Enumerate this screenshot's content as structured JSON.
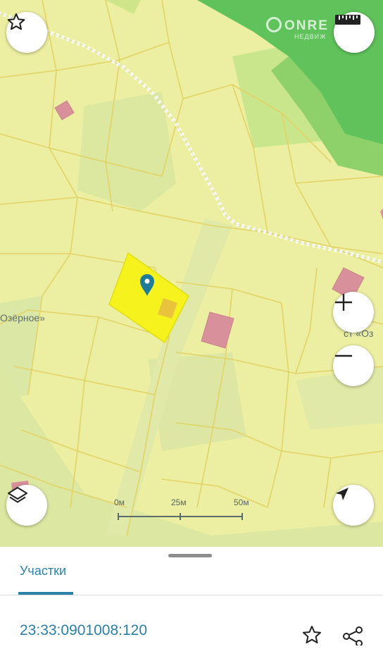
{
  "map": {
    "place_label_left": "Озёрное»",
    "place_label_right": "ст «Оз",
    "watermark": {
      "brand": "ONRE",
      "sub": "НЕДВИЖ",
      "icon": "onre-logo-icon"
    },
    "colors": {
      "parcel": "#ecefa1",
      "selected_parcel": "#f5f21e",
      "building": "#d8909a",
      "forest": "#5fc25a",
      "boundary_line": "#e5d86b"
    }
  },
  "controls": {
    "favorite_icon": "star-outline-icon",
    "measure_icon": "ruler-icon",
    "zoom_in_icon": "plus-icon",
    "zoom_out_icon": "minus-icon",
    "layers_icon": "layers-icon",
    "locate_icon": "navigation-arrow-icon"
  },
  "scale": {
    "labels": [
      "0м",
      "25м",
      "50м"
    ]
  },
  "sheet": {
    "tab_label": "Участки",
    "cadastral_number": "23:33:0901008:120",
    "actions": [
      "star-outline-icon",
      "share-icon"
    ]
  }
}
